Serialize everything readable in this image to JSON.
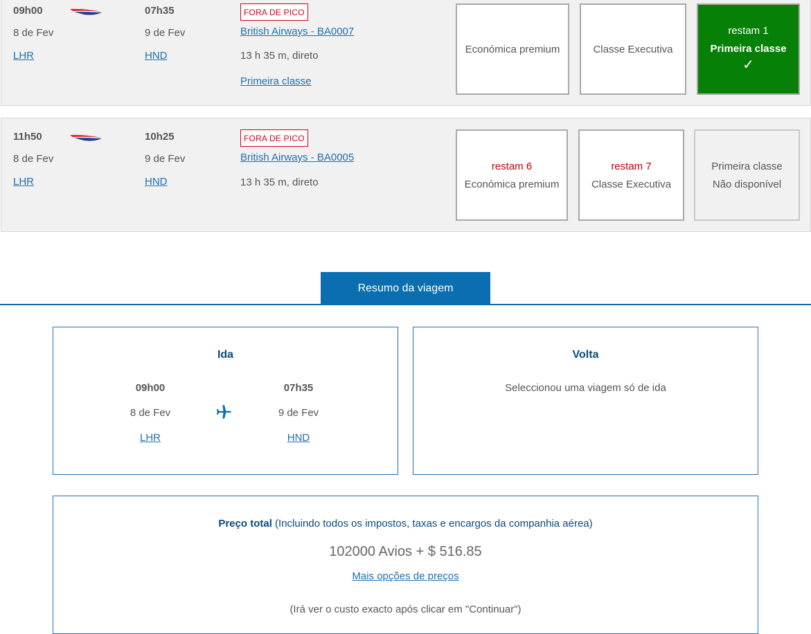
{
  "flights": [
    {
      "depart_time": "09h00",
      "depart_date": "8 de Fev",
      "depart_airport": "LHR",
      "arrive_time": "07h35",
      "arrive_date": "9 de Fev",
      "arrive_airport": "HND",
      "badge": "FORA DE PICO",
      "flight_name": "British Airways - BA0007",
      "duration": "13 h 35 m, direto",
      "cabin_link": "Primeira classe",
      "cabins": [
        {
          "name": "Económica premium",
          "remaining": "",
          "state": "available"
        },
        {
          "name": "Classe Executiva",
          "remaining": "",
          "state": "available"
        },
        {
          "name": "Primeira classe",
          "remaining": "restam 1",
          "state": "selected",
          "check": "✓"
        }
      ]
    },
    {
      "depart_time": "11h50",
      "depart_date": "8 de Fev",
      "depart_airport": "LHR",
      "arrive_time": "10h25",
      "arrive_date": "9 de Fev",
      "arrive_airport": "HND",
      "badge": "FORA DE PICO",
      "flight_name": "British Airways - BA0005",
      "duration": "13 h 35 m, direto",
      "cabins": [
        {
          "name": "Económica premium",
          "remaining": "restam 6",
          "state": "available"
        },
        {
          "name": "Classe Executiva",
          "remaining": "restam 7",
          "state": "available"
        },
        {
          "name": "Primeira classe",
          "status": "Não disponível",
          "state": "unavailable"
        }
      ]
    }
  ],
  "summary": {
    "tab_label": "Resumo da viagem",
    "outbound": {
      "title": "Ida",
      "depart_time": "09h00",
      "depart_date": "8 de Fev",
      "depart_airport": "LHR",
      "arrive_time": "07h35",
      "arrive_date": "9 de Fev",
      "arrive_airport": "HND"
    },
    "return": {
      "title": "Volta",
      "message": "Seleccionou uma viagem só de ida"
    },
    "price": {
      "label": "Preço total",
      "note": "(Incluindo todos os impostos, taxas e encargos da companhia aérea)",
      "amount": "102000 Avios + $ 516.85",
      "more_options": "Mais opções de preços",
      "footnote": "(Irá ver o custo exacto após clicar em \"Continuar\")"
    }
  },
  "colors": {
    "selected_green": "#068006",
    "accent_blue": "#0a6eb0",
    "link_blue": "#1f6fae",
    "warning_red": "#d0021b"
  },
  "icons": {
    "airline_logo": "british-airways-speedmarque-icon",
    "plane": "airplane-icon",
    "check": "checkmark-icon"
  }
}
